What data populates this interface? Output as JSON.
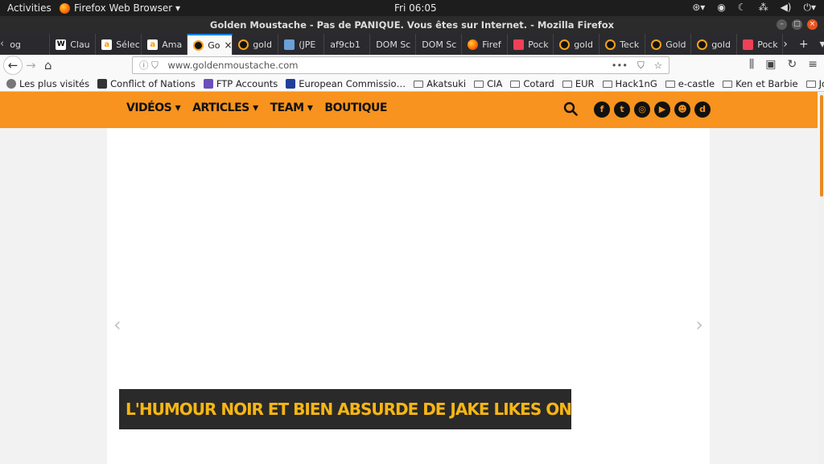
{
  "os": {
    "activities": "Activities",
    "app_menu": "Firefox Web Browser ▾",
    "clock": "Fri 06:05"
  },
  "window": {
    "title": "Golden Moustache - Pas de PANIQUE. Vous êtes sur Internet. - Mozilla Firefox"
  },
  "tabs": [
    {
      "label": "og",
      "icon": "generic"
    },
    {
      "label": "Clau",
      "icon": "wikipedia"
    },
    {
      "label": "Sélec",
      "icon": "amazon"
    },
    {
      "label": "Ama",
      "icon": "amazon"
    },
    {
      "label": "Go",
      "icon": "goldenmoustache",
      "active": true
    },
    {
      "label": "gold",
      "icon": "goldenmoustache"
    },
    {
      "label": "(JPE",
      "icon": "image"
    },
    {
      "label": "af9cb1",
      "icon": "none"
    },
    {
      "label": "DOM Sc",
      "icon": "none"
    },
    {
      "label": "DOM Sc",
      "icon": "none"
    },
    {
      "label": "Firef",
      "icon": "firefox"
    },
    {
      "label": "Pock",
      "icon": "pocket"
    },
    {
      "label": "gold",
      "icon": "goldenmoustache"
    },
    {
      "label": "Teck",
      "icon": "goldenmoustache"
    },
    {
      "label": "Gold",
      "icon": "goldenmoustache"
    },
    {
      "label": "gold",
      "icon": "goldenmoustache"
    },
    {
      "label": "Pock",
      "icon": "pocket"
    }
  ],
  "address": {
    "url": "www.goldenmoustache.com"
  },
  "bookmarks": [
    {
      "label": "Les plus visités",
      "icon": "gear-icon"
    },
    {
      "label": "Conflict of Nations",
      "icon": "cross-icon"
    },
    {
      "label": "FTP Accounts",
      "icon": "ftp-icon"
    },
    {
      "label": "European Commissio…",
      "icon": "eu-flag-icon"
    },
    {
      "label": "Akatsuki",
      "icon": "folder-icon"
    },
    {
      "label": "CIA",
      "icon": "folder-icon"
    },
    {
      "label": "Cotard",
      "icon": "folder-icon"
    },
    {
      "label": "EUR",
      "icon": "folder-icon"
    },
    {
      "label": "Hack1nG",
      "icon": "folder-icon"
    },
    {
      "label": "e-castle",
      "icon": "folder-icon"
    },
    {
      "label": "Ken et Barbie",
      "icon": "folder-icon"
    },
    {
      "label": "Job",
      "icon": "folder-icon"
    }
  ],
  "site": {
    "menu": [
      "VIDÉOS ▾",
      "ARTICLES ▾",
      "TEAM ▾",
      "BOUTIQUE"
    ],
    "socials": [
      "f",
      "t",
      "◎",
      "▶",
      "☻",
      "d"
    ],
    "headline": "L'HUMOUR NOIR ET BIEN ABSURDE DE JAKE LIKES ONIONS EN COMICS",
    "prev": "‹",
    "next": "›"
  },
  "colors": {
    "brand_orange": "#f7931e",
    "headline_yellow": "#f7b614",
    "headline_bg": "#2a2a2a"
  }
}
